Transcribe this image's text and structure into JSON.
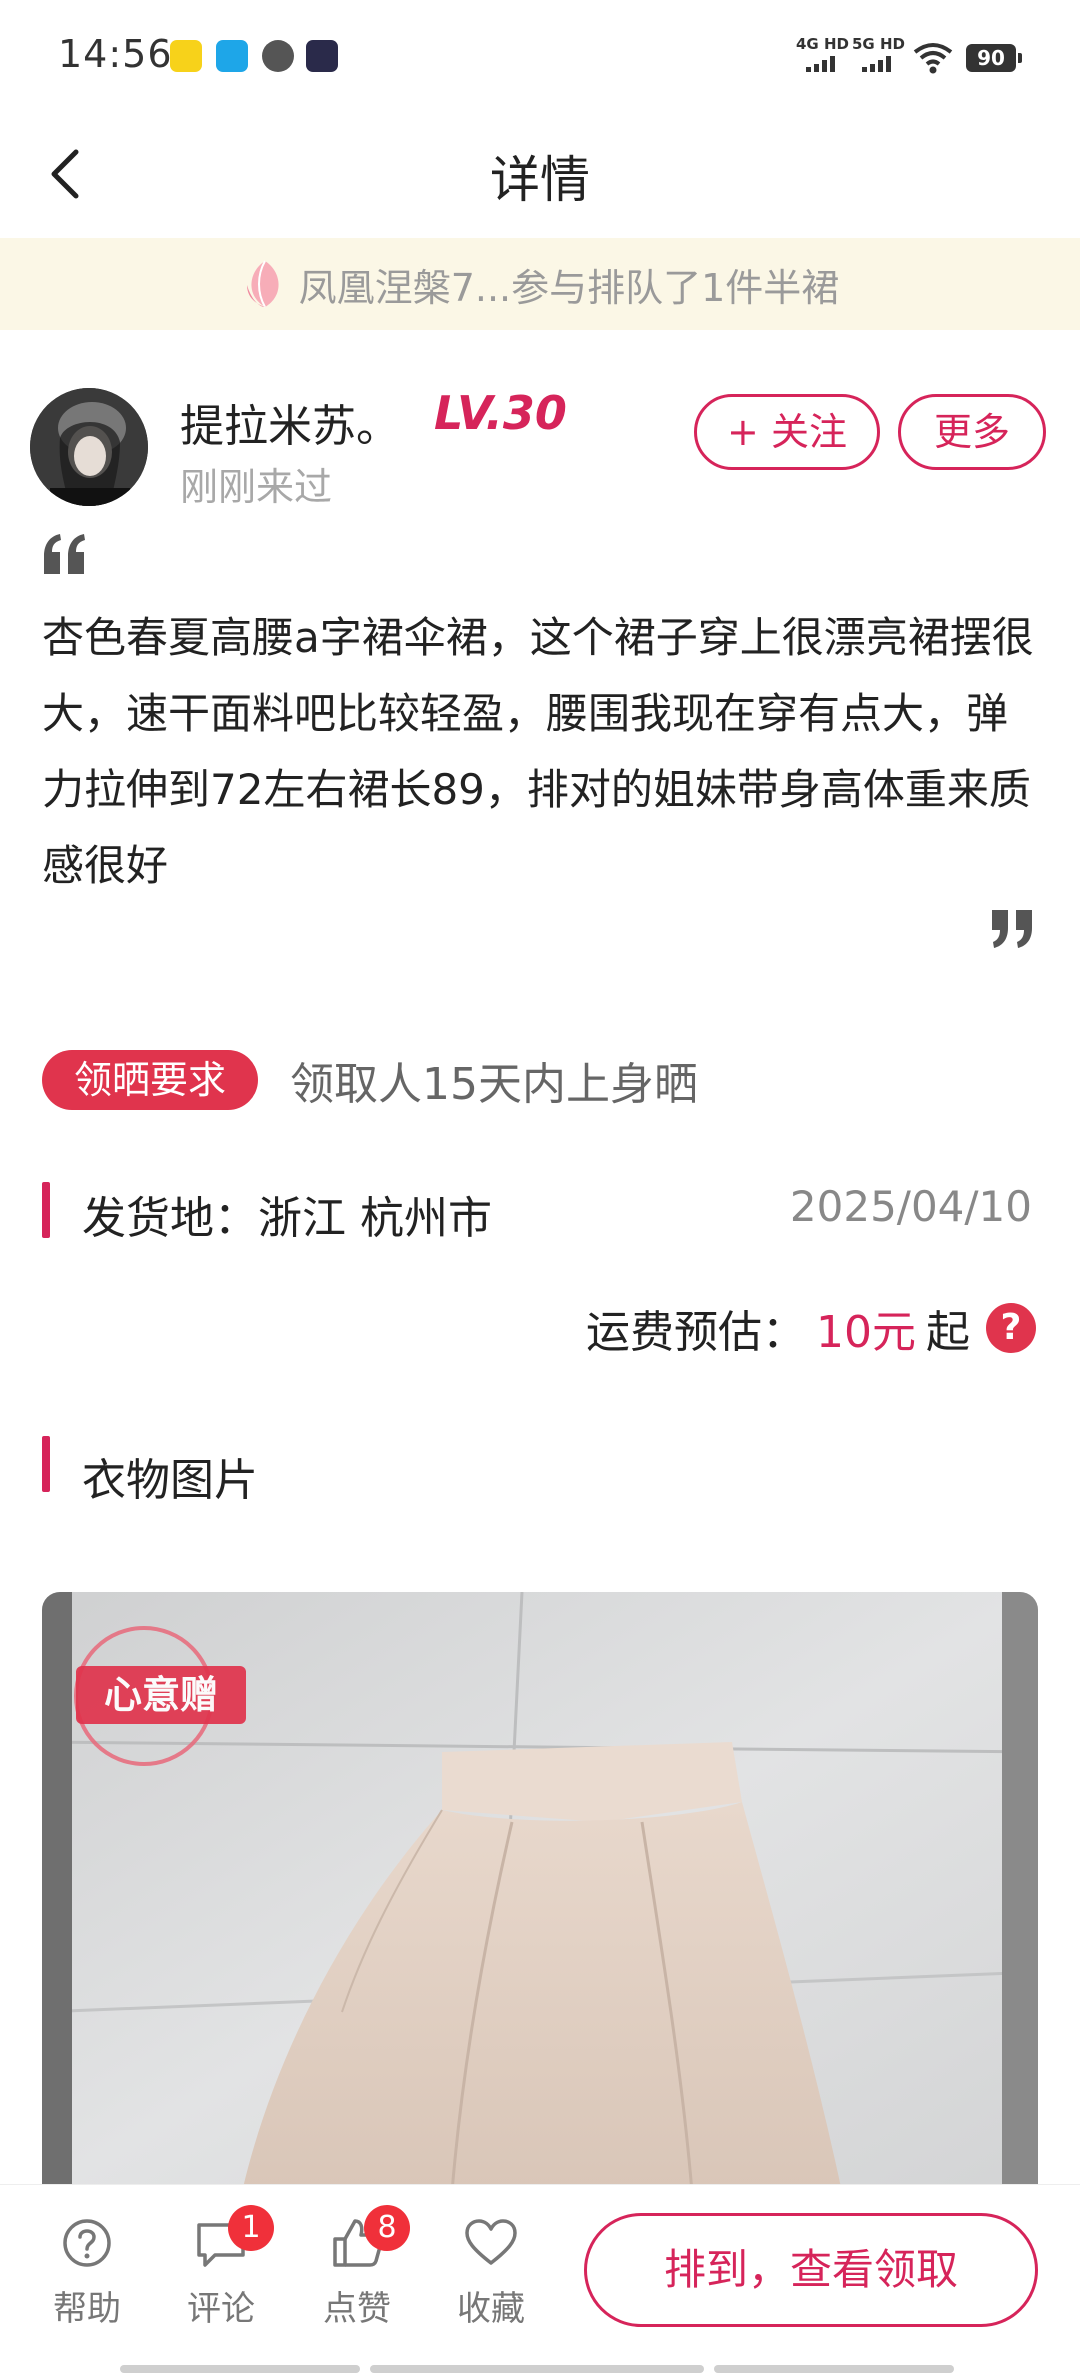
{
  "status_bar": {
    "time": "14:56",
    "network1": "4G HD",
    "network2": "5G HD",
    "battery": "90"
  },
  "nav": {
    "title": "详情"
  },
  "notice": {
    "text": "凤凰涅槃7...参与排队了1件半裙"
  },
  "user": {
    "name": "提拉米苏。",
    "level": "LV.30",
    "last_visit": "刚刚来过",
    "follow_label": "+ 关注",
    "more_label": "更多"
  },
  "description": "杏色春夏高腰a字裙伞裙，这个裙子穿上很漂亮裙摆很大，速干面料吧比较轻盈，腰围我现在穿有点大，弹力拉伸到72左右裙长89，排对的姐妹带身高体重来质感很好",
  "requirement": {
    "badge": "领晒要求",
    "text": "领取人15天内上身晒"
  },
  "shipping": {
    "origin": "发货地：浙江 杭州市",
    "date": "2025/04/10",
    "fee_label": "运费预估：",
    "fee_value": "10元",
    "fee_suffix": "起",
    "fee_help": "?"
  },
  "photos": {
    "title": "衣物图片",
    "stamp": "心意赠"
  },
  "bottom": {
    "help": "帮助",
    "comment": "评论",
    "comment_count": "1",
    "like": "点赞",
    "like_count": "8",
    "favorite": "收藏",
    "cta": "排到，查看领取"
  },
  "colors": {
    "accent": "#d6245a",
    "badge_red": "#e0344d",
    "notice_bg": "#fbf7e6"
  }
}
